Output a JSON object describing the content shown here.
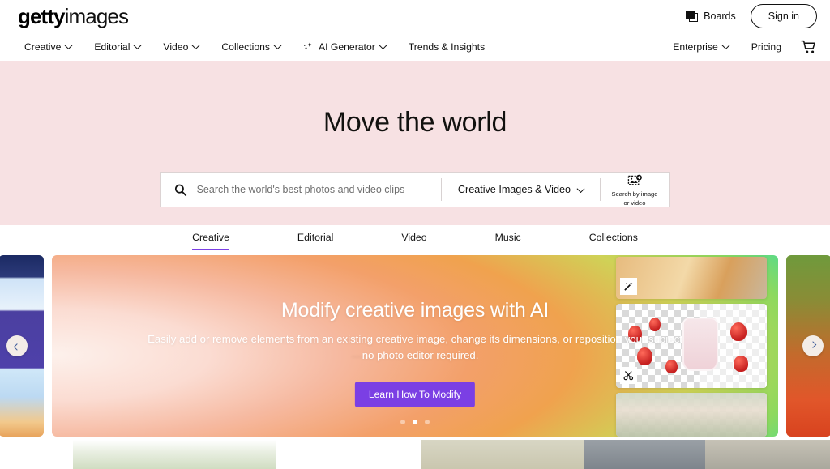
{
  "header": {
    "logo_bold": "getty",
    "logo_light": "images",
    "boards_label": "Boards",
    "boards_icon": "boards-stacked-squares-icon",
    "signin_label": "Sign in"
  },
  "nav": {
    "left_items": [
      {
        "label": "Creative",
        "has_chevron": true
      },
      {
        "label": "Editorial",
        "has_chevron": true
      },
      {
        "label": "Video",
        "has_chevron": true
      },
      {
        "label": "Collections",
        "has_chevron": true
      },
      {
        "label": "AI Generator",
        "has_chevron": true,
        "icon": "sparkle-icon"
      },
      {
        "label": "Trends & Insights",
        "has_chevron": false
      }
    ],
    "right_items": [
      {
        "label": "Enterprise",
        "has_chevron": true
      },
      {
        "label": "Pricing",
        "has_chevron": false
      }
    ],
    "cart_icon": "shopping-cart-icon"
  },
  "hero": {
    "title": "Move the world",
    "background_color": "#f7e1e3",
    "search": {
      "icon": "search-magnifier-icon",
      "placeholder": "Search the world's best photos and video clips",
      "value": "",
      "filter_label": "Creative Images & Video",
      "image_search_icon": "image-upload-search-icon",
      "image_search_line1": "Search by image",
      "image_search_line2": "or video"
    }
  },
  "tabs": {
    "items": [
      {
        "label": "Creative",
        "active": true
      },
      {
        "label": "Editorial",
        "active": false
      },
      {
        "label": "Video",
        "active": false
      },
      {
        "label": "Music",
        "active": false
      },
      {
        "label": "Collections",
        "active": false
      }
    ],
    "active_underline_color": "#7b3fe4"
  },
  "carousel": {
    "slide": {
      "heading": "Modify creative images with AI",
      "subtitle": "Easily add or remove elements from an existing creative image, change its dimensions, or reposition your subject—no photo editor required.",
      "cta_label": "Learn How To Modify",
      "cta_color": "#7b3fe4"
    },
    "prev_button_icon": "chevron-left-icon",
    "next_button_icon": "chevron-right-icon",
    "dots": [
      {
        "active": false
      },
      {
        "active": true
      },
      {
        "active": false
      }
    ],
    "cards": [
      {
        "name": "pastry-pie-thumbnail",
        "badge_icon": "magic-wand-icon"
      },
      {
        "name": "strawberry-milk-thumbnail",
        "badge_icon": "scissors-icon"
      },
      {
        "name": "couple-outdoors-thumbnail",
        "badge_icon": ""
      }
    ]
  }
}
